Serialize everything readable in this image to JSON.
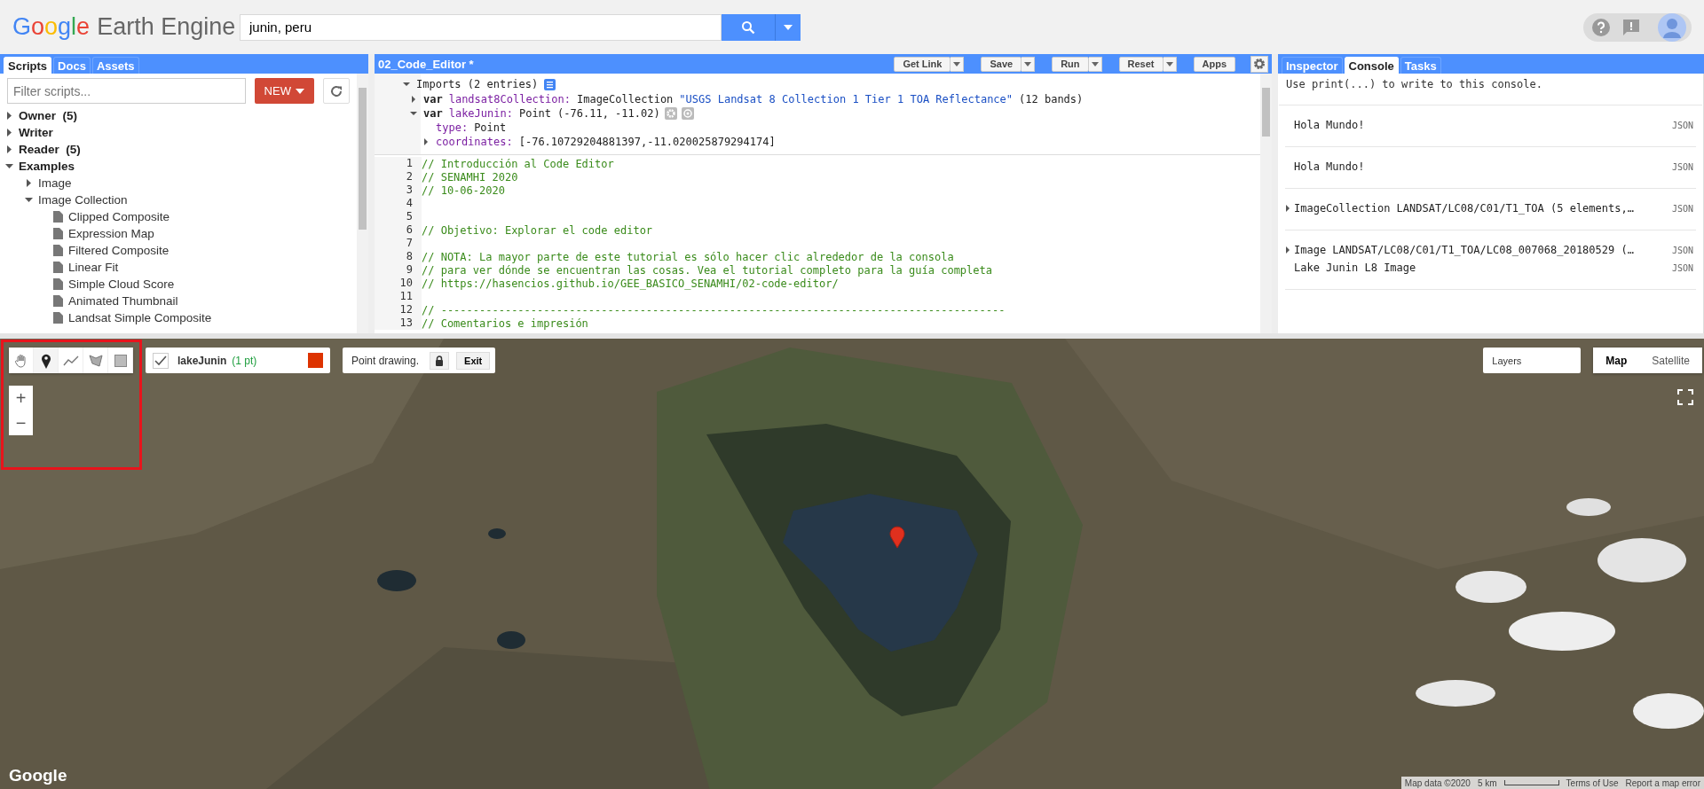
{
  "header": {
    "logo_brand": "Google",
    "logo_product": "Earth Engine",
    "search": {
      "value": "junin, peru"
    }
  },
  "left_panel": {
    "tabs": [
      {
        "label": "Scripts",
        "selected": true
      },
      {
        "label": "Docs",
        "selected": false
      },
      {
        "label": "Assets",
        "selected": false
      }
    ],
    "filter": {
      "placeholder": "Filter scripts..."
    },
    "new_button": "NEW",
    "tree": [
      {
        "kind": "folder",
        "label": "Owner",
        "count": "(5)",
        "expanded": false
      },
      {
        "kind": "folder",
        "label": "Writer",
        "expanded": false
      },
      {
        "kind": "folder",
        "label": "Reader",
        "count": "(5)",
        "expanded": false
      },
      {
        "kind": "folder",
        "label": "Examples",
        "expanded": true,
        "children": [
          {
            "kind": "folder",
            "label": "Image",
            "expanded": false
          },
          {
            "kind": "folder",
            "label": "Image Collection",
            "expanded": true,
            "children": [
              {
                "kind": "file",
                "label": "Clipped Composite"
              },
              {
                "kind": "file",
                "label": "Expression Map"
              },
              {
                "kind": "file",
                "label": "Filtered Composite"
              },
              {
                "kind": "file",
                "label": "Linear Fit"
              },
              {
                "kind": "file",
                "label": "Simple Cloud Score"
              },
              {
                "kind": "file",
                "label": "Animated Thumbnail"
              },
              {
                "kind": "file",
                "label": "Landsat Simple Composite"
              }
            ]
          }
        ]
      }
    ]
  },
  "editor": {
    "title": "02_Code_Editor *",
    "buttons": [
      {
        "label": "Get Link",
        "dropdown": true
      },
      {
        "label": "Save",
        "dropdown": true
      },
      {
        "label": "Run",
        "dropdown": true
      },
      {
        "label": "Reset",
        "dropdown": true
      },
      {
        "label": "Apps",
        "dropdown": false
      }
    ],
    "imports": {
      "label": "Imports (2 entries)",
      "expanded": true,
      "entries": [
        {
          "keyword": "var",
          "name": "landsat8Collection:",
          "type": "ImageCollection",
          "value": "\"USGS Landsat 8 Collection 1 Tier 1 TOA Reflectance\"",
          "extra": "(12 bands)",
          "expanded": false
        },
        {
          "keyword": "var",
          "name": "lakeJunin:",
          "type": "Point",
          "extra": "(-76.11, -11.02)",
          "expanded": true,
          "children": [
            {
              "key": "type:",
              "value": "Point"
            },
            {
              "key": "coordinates:",
              "value": "[-76.10729204881397,-11.020025879294174]",
              "expanded": false
            }
          ]
        }
      ]
    },
    "lines": [
      {
        "number": "1",
        "text": "// Introducción al Code Editor"
      },
      {
        "number": "2",
        "text": "// SENAMHI 2020"
      },
      {
        "number": "3",
        "text": "// 10-06-2020"
      },
      {
        "number": "4"
      },
      {
        "number": "5"
      },
      {
        "number": "6",
        "text": "// Objetivo: Explorar el code editor"
      },
      {
        "number": "7"
      },
      {
        "number": "8",
        "text": "// NOTA: La mayor parte de este tutorial es sólo hacer clic alrededor de la consola"
      },
      {
        "number": "9",
        "text": "// para ver dónde se encuentran las cosas. Vea el tutorial completo para la guía completa"
      },
      {
        "number": "10",
        "text": "// https://hasencios.github.io/GEE_BASICO_SENAMHI/02-code-editor/"
      },
      {
        "number": "11"
      },
      {
        "number": "12",
        "text": "// ----------------------------------------------------------------------------------------"
      },
      {
        "number": "13",
        "text": "// Comentarios e impresión"
      }
    ]
  },
  "console_panel": {
    "tabs": [
      {
        "label": "Inspector",
        "selected": false
      },
      {
        "label": "Console",
        "selected": true
      },
      {
        "label": "Tasks",
        "selected": false
      }
    ],
    "hint": "Use print(...) to write to this console.",
    "entries": [
      {
        "lines": [
          {
            "text": "Hola Mundo!",
            "link": "JSON"
          }
        ]
      },
      {
        "lines": [
          {
            "text": "Hola Mundo!",
            "link": "JSON"
          }
        ]
      },
      {
        "lines": [
          {
            "text": "ImageCollection LANDSAT/LC08/C01/T1_TOA (5 elements,…",
            "link": "JSON",
            "expanded": false
          }
        ]
      },
      {
        "lines": [
          {
            "text": "Image LANDSAT/LC08/C01/T1_TOA/LC08_007068_20180529 (…",
            "link": "JSON",
            "expanded": false
          },
          {
            "text": "Lake Junin L8 Image",
            "link": "JSON"
          }
        ]
      }
    ]
  },
  "map": {
    "tools": [
      {
        "kind": "hand",
        "selected": false
      },
      {
        "kind": "point",
        "selected": true
      },
      {
        "kind": "line",
        "selected": false
      },
      {
        "kind": "polygon",
        "selected": false
      },
      {
        "kind": "rectangle",
        "selected": false
      }
    ],
    "zoom": [
      "+",
      "−"
    ],
    "layer": {
      "checked": true,
      "name": "lakeJunin",
      "count": "(1 pt)",
      "color": "#dd3300"
    },
    "drawing": {
      "status": "Point drawing.",
      "exit": "Exit"
    },
    "layers_menu": "Layers",
    "map_types": [
      {
        "label": "Map",
        "selected": true
      },
      {
        "label": "Satellite",
        "selected": false
      }
    ],
    "logo": "Google",
    "footer": {
      "attribution": "Map data ©2020",
      "scale": "5 km",
      "terms": "Terms of Use",
      "report": "Report a map error"
    }
  }
}
